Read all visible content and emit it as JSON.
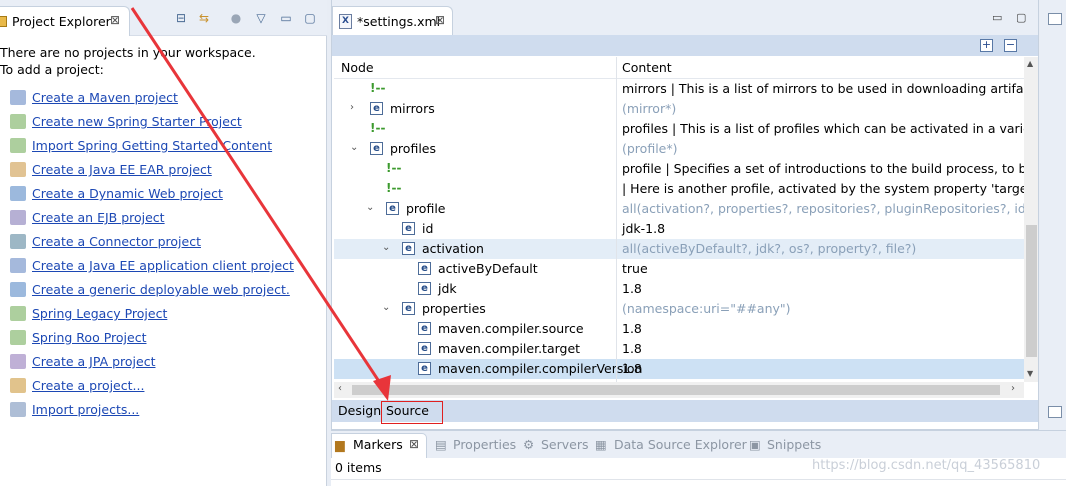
{
  "project_explorer": {
    "title": "Project Explorer",
    "close": "⊠",
    "message_line1": "There are no projects in your workspace.",
    "message_line2": "To add a project:",
    "links": [
      {
        "label": "Create a Maven project",
        "icon": "maven-icon"
      },
      {
        "label": "Create new Spring Starter Project",
        "icon": "spring-icon"
      },
      {
        "label": "Import Spring Getting Started Content",
        "icon": "spring-import-icon"
      },
      {
        "label": "Create a Java EE EAR project",
        "icon": "ear-icon"
      },
      {
        "label": "Create a Dynamic Web project",
        "icon": "web-project-icon"
      },
      {
        "label": "Create an EJB project",
        "icon": "ejb-icon"
      },
      {
        "label": "Create a Connector project",
        "icon": "connector-icon"
      },
      {
        "label": "Create a Java EE application client project",
        "icon": "app-client-icon"
      },
      {
        "label": "Create a generic deployable web project.",
        "icon": "generic-web-icon"
      },
      {
        "label": "Spring Legacy Project",
        "icon": "spring-legacy-icon"
      },
      {
        "label": "Spring Roo Project",
        "icon": "spring-roo-icon"
      },
      {
        "label": "Create a JPA project",
        "icon": "jpa-icon"
      },
      {
        "label": "Create a project...",
        "icon": "new-project-icon"
      },
      {
        "label": "Import projects...",
        "icon": "import-icon"
      }
    ]
  },
  "editor": {
    "tab_title": "*settings.xml",
    "tab_close": "⊠",
    "columns": {
      "node": "Node",
      "content": "Content"
    },
    "rows": [
      {
        "twisty": "",
        "icon": "comment",
        "node": "",
        "content": "mirrors   | This is a list of mirrors to be used in downloading artifact",
        "gray": false
      },
      {
        "twisty": "›",
        "icon": "element",
        "node": "mirrors",
        "content": "(mirror*)",
        "gray": true
      },
      {
        "twisty": "",
        "icon": "comment",
        "node": "",
        "content": "profiles   | This is a list of profiles which can be activated in a variety",
        "gray": false
      },
      {
        "twisty": "⌄",
        "icon": "element",
        "node": "profiles",
        "content": "(profile*)",
        "gray": true
      },
      {
        "twisty": "",
        "icon": "comment",
        "node": "",
        "content": "profile    | Specifies a set of introductions to the build process, to b",
        "gray": false
      },
      {
        "twisty": "",
        "icon": "comment",
        "node": "",
        "content": "   | Here is another profile, activated by the system property 'target-",
        "gray": false
      },
      {
        "twisty": "⌄",
        "icon": "element",
        "node": "profile",
        "content": "all(activation?, properties?, repositories?, pluginRepositories?, id?)",
        "gray": true
      },
      {
        "twisty": "",
        "icon": "element",
        "node": "id",
        "content": "jdk-1.8",
        "gray": false
      },
      {
        "twisty": "⌄",
        "icon": "element",
        "node": "activation",
        "content": "all(activeByDefault?, jdk?, os?, property?, file?)",
        "gray": true
      },
      {
        "twisty": "",
        "icon": "element",
        "node": "activeByDefault",
        "content": "true",
        "gray": false
      },
      {
        "twisty": "",
        "icon": "element",
        "node": "jdk",
        "content": "1.8",
        "gray": false
      },
      {
        "twisty": "⌄",
        "icon": "element",
        "node": "properties",
        "content": "(namespace:uri=\"##any\")",
        "gray": true
      },
      {
        "twisty": "",
        "icon": "element",
        "node": "maven.compiler.source",
        "content": "1.8",
        "gray": false
      },
      {
        "twisty": "",
        "icon": "element",
        "node": "maven.compiler.target",
        "content": "1.8",
        "gray": false
      },
      {
        "twisty": "",
        "icon": "element",
        "node": "maven.compiler.compilerVersion",
        "content": "1.8",
        "gray": false
      }
    ],
    "comment_glyph": "!--",
    "element_glyph": "e",
    "design_tab": "Design",
    "source_tab": "Source"
  },
  "bottom_panel": {
    "tabs": [
      {
        "label": "Markers",
        "active": true
      },
      {
        "label": "Properties",
        "active": false
      },
      {
        "label": "Servers",
        "active": false
      },
      {
        "label": "Data Source Explorer",
        "active": false
      },
      {
        "label": "Snippets",
        "active": false
      }
    ],
    "markers_close": "⊠",
    "items_count": "0 items"
  },
  "watermark": "https://blog.csdn.net/qq_43565810",
  "colors": {
    "link": "#1c48b4",
    "arrow": "#e8353a",
    "highlight_box": "#e02020"
  }
}
